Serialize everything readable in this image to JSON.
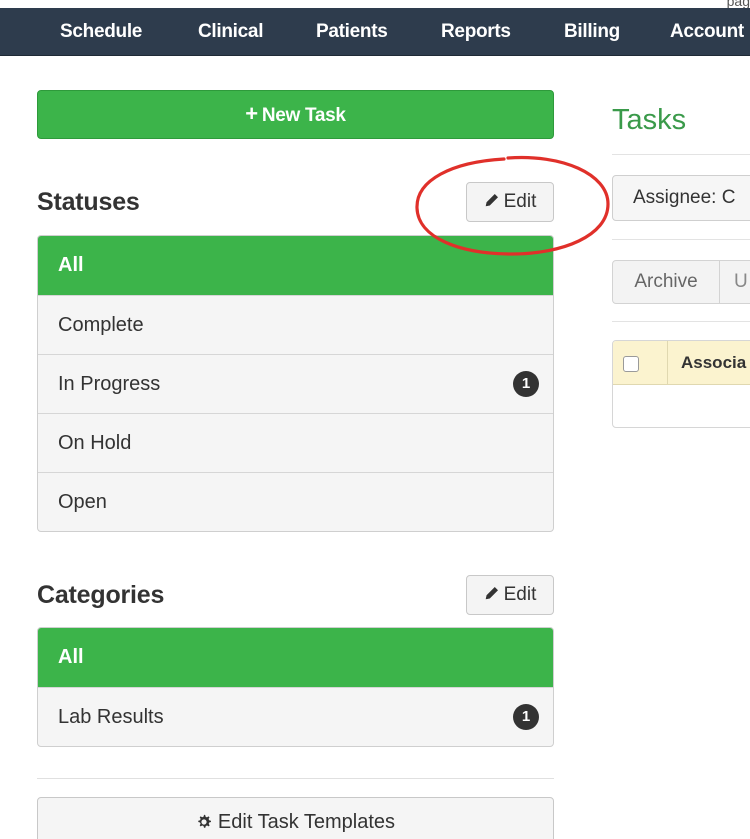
{
  "top_strip": {
    "text": "pag"
  },
  "navbar": {
    "items": [
      "Schedule",
      "Clinical",
      "Patients",
      "Reports",
      "Billing",
      "Account"
    ]
  },
  "sidebar": {
    "new_task_label": "New Task",
    "edit_label": "Edit",
    "statuses": {
      "title": "Statuses",
      "items": [
        {
          "label": "All"
        },
        {
          "label": "Complete"
        },
        {
          "label": "In Progress",
          "count": "1"
        },
        {
          "label": "On Hold"
        },
        {
          "label": "Open"
        }
      ]
    },
    "categories": {
      "title": "Categories",
      "items": [
        {
          "label": "All"
        },
        {
          "label": "Lab Results",
          "count": "1"
        }
      ]
    },
    "edit_templates_label": "Edit Task Templates"
  },
  "main": {
    "title": "Tasks",
    "assignee_filter": "Assignee: C",
    "archive_label": "Archive",
    "next_button_label": "U",
    "table": {
      "column_header": "Associa"
    }
  },
  "colors": {
    "navbar_bg": "#2e3c4d",
    "accent_green": "#3cb44a",
    "title_green": "#3a9a4a",
    "annotation_red": "#e0302a",
    "table_header_bg": "#fbf3cf"
  }
}
